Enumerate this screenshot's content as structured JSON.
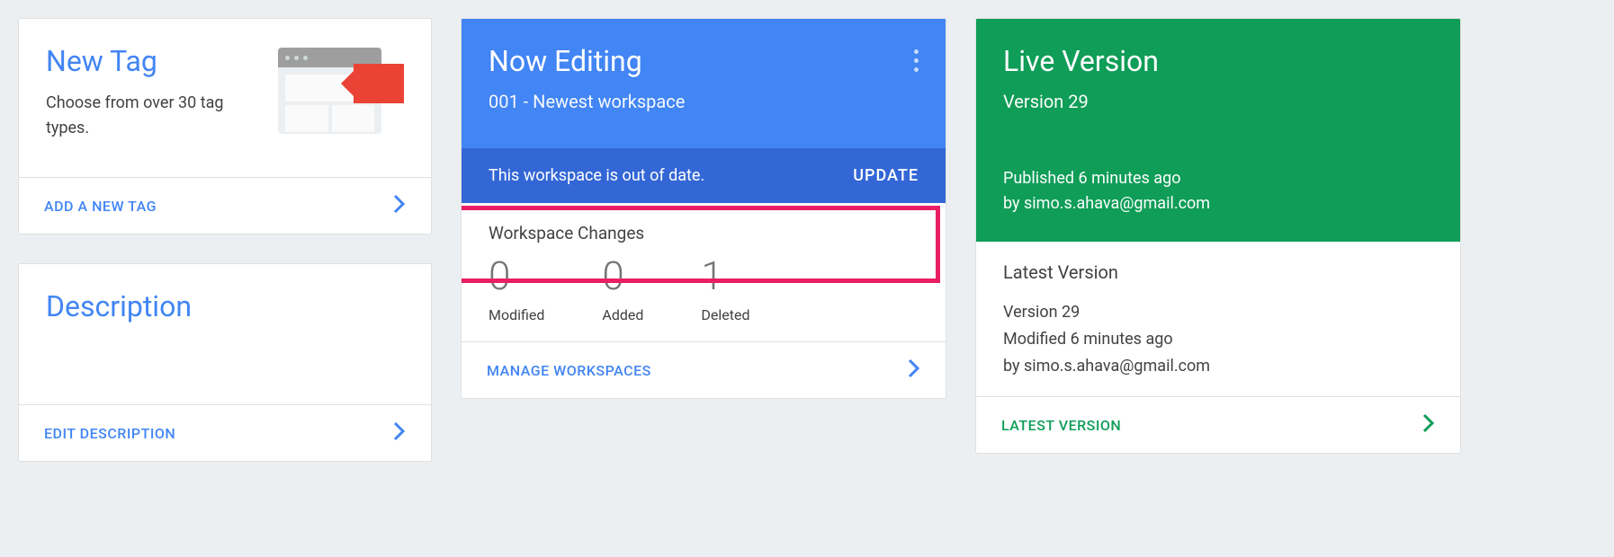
{
  "newtag": {
    "title": "New Tag",
    "subtitle": "Choose from over 30 tag types.",
    "action": "ADD A NEW TAG"
  },
  "description": {
    "title": "Description",
    "action": "EDIT DESCRIPTION"
  },
  "editing": {
    "title": "Now Editing",
    "subtitle": "001 - Newest workspace",
    "banner_text": "This workspace is out of date.",
    "banner_button": "UPDATE",
    "changes_title": "Workspace Changes",
    "stats": {
      "modified": {
        "value": "0",
        "label": "Modified"
      },
      "added": {
        "value": "0",
        "label": "Added"
      },
      "deleted": {
        "value": "1",
        "label": "Deleted"
      }
    },
    "action": "MANAGE WORKSPACES"
  },
  "live": {
    "title": "Live Version",
    "subtitle": "Version 29",
    "published": "Published 6 minutes ago",
    "published_by": "by simo.s.ahava@gmail.com",
    "latest_title": "Latest Version",
    "latest_version": "Version 29",
    "latest_modified": "Modified 6 minutes ago",
    "latest_by": "by simo.s.ahava@gmail.com",
    "action": "LATEST VERSION"
  }
}
